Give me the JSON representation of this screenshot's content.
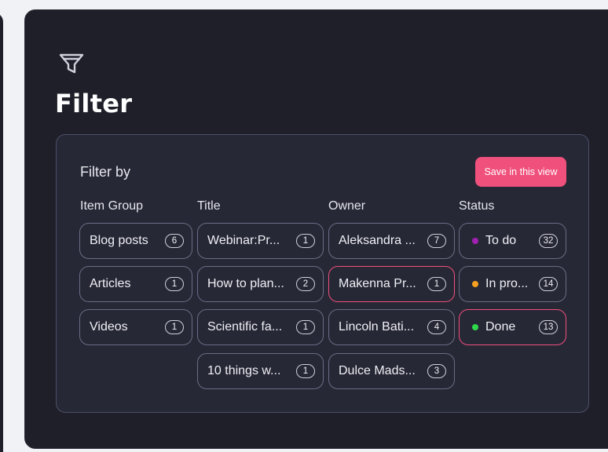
{
  "panel": {
    "title": "Filter"
  },
  "card": {
    "filter_by_label": "Filter by",
    "save_label": "Save in this view"
  },
  "columns": {
    "item_group": {
      "header": "Item Group",
      "chips": [
        {
          "label": "Blog posts",
          "count": "6"
        },
        {
          "label": "Articles",
          "count": "1"
        },
        {
          "label": "Videos",
          "count": "1"
        }
      ]
    },
    "title": {
      "header": "Title",
      "chips": [
        {
          "label": "Webinar:Pr...",
          "count": "1"
        },
        {
          "label": "How to plan...",
          "count": "2"
        },
        {
          "label": "Scientific fa...",
          "count": "1"
        },
        {
          "label": "10 things w...",
          "count": "1"
        }
      ]
    },
    "owner": {
      "header": "Owner",
      "chips": [
        {
          "label": "Aleksandra ...",
          "count": "7",
          "selected": false
        },
        {
          "label": "Makenna Pr...",
          "count": "1",
          "selected": true
        },
        {
          "label": "Lincoln Bati...",
          "count": "4",
          "selected": false
        },
        {
          "label": "Dulce Mads...",
          "count": "3",
          "selected": false
        }
      ]
    },
    "status": {
      "header": "Status",
      "chips": [
        {
          "label": "To do",
          "count": "32",
          "dot_color": "#a020b0",
          "selected": false
        },
        {
          "label": "In pro...",
          "count": "14",
          "dot_color": "#f5a020",
          "selected": false
        },
        {
          "label": "Done",
          "count": "13",
          "dot_color": "#2ed84a",
          "selected": true
        }
      ]
    }
  },
  "colors": {
    "panel_bg": "#1e1f28",
    "card_bg": "#272836",
    "accent": "#f0507c",
    "chip_border": "#6a6c84"
  },
  "icons": {
    "filter": "filter-funnel-icon"
  }
}
